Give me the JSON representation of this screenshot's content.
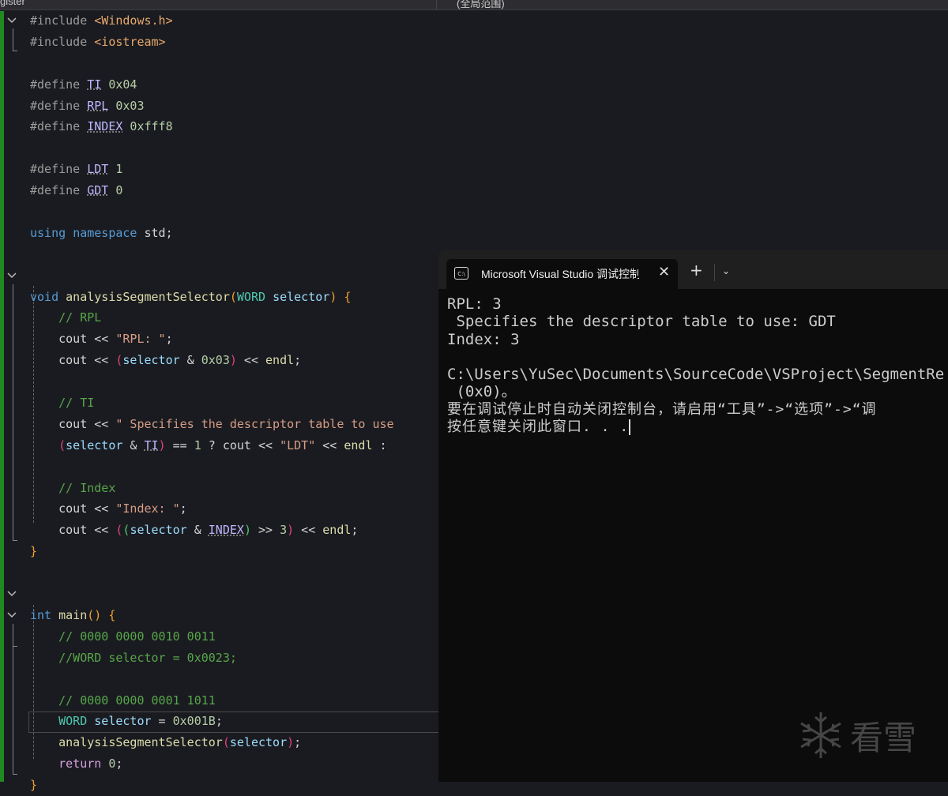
{
  "topbar": {
    "left": "gister",
    "right": "(全局范围)"
  },
  "code": {
    "lines": [
      [
        [
          "#include ",
          "pp"
        ],
        [
          "<Windows.h>",
          "inc"
        ]
      ],
      [
        [
          "#include ",
          "pp"
        ],
        [
          "<iostream>",
          "inc"
        ]
      ],
      [],
      [
        [
          "#define ",
          "pp"
        ],
        [
          "TI",
          "mac"
        ],
        [
          " 0x04",
          "num"
        ]
      ],
      [
        [
          "#define ",
          "pp"
        ],
        [
          "RPL",
          "mac"
        ],
        [
          " 0x03",
          "num"
        ]
      ],
      [
        [
          "#define ",
          "pp"
        ],
        [
          "INDEX",
          "mac"
        ],
        [
          " 0xfff8",
          "num"
        ]
      ],
      [],
      [
        [
          "#define ",
          "pp"
        ],
        [
          "LDT",
          "mac"
        ],
        [
          " 1",
          "num"
        ]
      ],
      [
        [
          "#define ",
          "pp"
        ],
        [
          "GDT",
          "mac"
        ],
        [
          " 0",
          "num"
        ]
      ],
      [],
      [
        [
          "using ",
          "kw"
        ],
        [
          "namespace ",
          "kw"
        ],
        [
          "std;",
          "id"
        ]
      ],
      [],
      [],
      [
        [
          "void ",
          "kw"
        ],
        [
          "analysisSegmentSelector",
          "fn"
        ],
        [
          "(",
          "br"
        ],
        [
          "WORD ",
          "ty"
        ],
        [
          "selector",
          "pa"
        ],
        [
          ") ",
          "br"
        ],
        [
          "{",
          "br"
        ]
      ],
      [
        [
          "    // RPL",
          "cm"
        ]
      ],
      [
        [
          "    cout << ",
          "id"
        ],
        [
          "\"RPL: \"",
          "str"
        ],
        [
          ";",
          "id"
        ]
      ],
      [
        [
          "    cout << ",
          "id"
        ],
        [
          "(",
          "p1"
        ],
        [
          "selector",
          "pa"
        ],
        [
          " & ",
          "id"
        ],
        [
          "0x03",
          "num"
        ],
        [
          ")",
          "p1"
        ],
        [
          " << ",
          "id"
        ],
        [
          "endl",
          "fn"
        ],
        [
          ";",
          "id"
        ]
      ],
      [],
      [
        [
          "    // TI",
          "cm"
        ]
      ],
      [
        [
          "    cout << ",
          "id"
        ],
        [
          "\" Specifies the descriptor table to use",
          "str"
        ]
      ],
      [
        [
          "    ",
          "id"
        ],
        [
          "(",
          "p1"
        ],
        [
          "selector",
          "pa"
        ],
        [
          " & ",
          "id"
        ],
        [
          "TI",
          "mac"
        ],
        [
          ")",
          "p1"
        ],
        [
          " == ",
          "id"
        ],
        [
          "1",
          "num"
        ],
        [
          " ? cout << ",
          "id"
        ],
        [
          "\"LDT\"",
          "str"
        ],
        [
          " << ",
          "id"
        ],
        [
          "endl",
          "fn"
        ],
        [
          " :",
          "id"
        ]
      ],
      [],
      [
        [
          "    // Index",
          "cm"
        ]
      ],
      [
        [
          "    cout << ",
          "id"
        ],
        [
          "\"Index: \"",
          "str"
        ],
        [
          ";",
          "id"
        ]
      ],
      [
        [
          "    cout << ",
          "id"
        ],
        [
          "(",
          "p1"
        ],
        [
          "(",
          "p2"
        ],
        [
          "selector",
          "pa"
        ],
        [
          " & ",
          "id"
        ],
        [
          "INDEX",
          "mac"
        ],
        [
          ")",
          "p2"
        ],
        [
          " >> ",
          "id"
        ],
        [
          "3",
          "num"
        ],
        [
          ")",
          "p1"
        ],
        [
          " << ",
          "id"
        ],
        [
          "endl",
          "fn"
        ],
        [
          ";",
          "id"
        ]
      ],
      [
        [
          "}",
          "br"
        ]
      ],
      [],
      [],
      [
        [
          "int ",
          "kw"
        ],
        [
          "main",
          "fn"
        ],
        [
          "() ",
          "br"
        ],
        [
          "{",
          "br"
        ]
      ],
      [
        [
          "    // 0000 0000 0010 0011",
          "cm"
        ]
      ],
      [
        [
          "    //WORD selector = 0x0023;",
          "cm"
        ]
      ],
      [],
      [
        [
          "    // 0000 0000 0001 1011",
          "cm"
        ]
      ],
      [
        [
          "    ",
          "id"
        ],
        [
          "WORD ",
          "ty"
        ],
        [
          "selector",
          "pa"
        ],
        [
          " = ",
          "id"
        ],
        [
          "0x001B",
          "num"
        ],
        [
          ";",
          "id"
        ]
      ],
      [
        [
          "    ",
          "id"
        ],
        [
          "analysisSegmentSelector",
          "fn"
        ],
        [
          "(",
          "p1"
        ],
        [
          "selector",
          "pa"
        ],
        [
          ")",
          "p1"
        ],
        [
          ";",
          "id"
        ]
      ],
      [
        [
          "    ",
          "id"
        ],
        [
          "return ",
          "ret"
        ],
        [
          "0",
          "num"
        ],
        [
          ";",
          "id"
        ]
      ],
      [
        [
          "}",
          "br"
        ]
      ]
    ]
  },
  "console": {
    "tab_title": "Microsoft Visual Studio 调试控制台",
    "icon_text": "C:\\",
    "close": "✕",
    "new_tab": "+",
    "dropdown": "⌄",
    "output": [
      "RPL: 3",
      " Specifies the descriptor table to use: GDT",
      "Index: 3",
      "",
      "C:\\Users\\YuSec\\Documents\\SourceCode\\VSProject\\SegmentRe",
      " (0x0)。",
      "要在调试停止时自动关闭控制台，请启用“工具”->“选项”->“调",
      "按任意键关闭此窗口. . ."
    ]
  },
  "watermark": {
    "text": "看雪"
  }
}
